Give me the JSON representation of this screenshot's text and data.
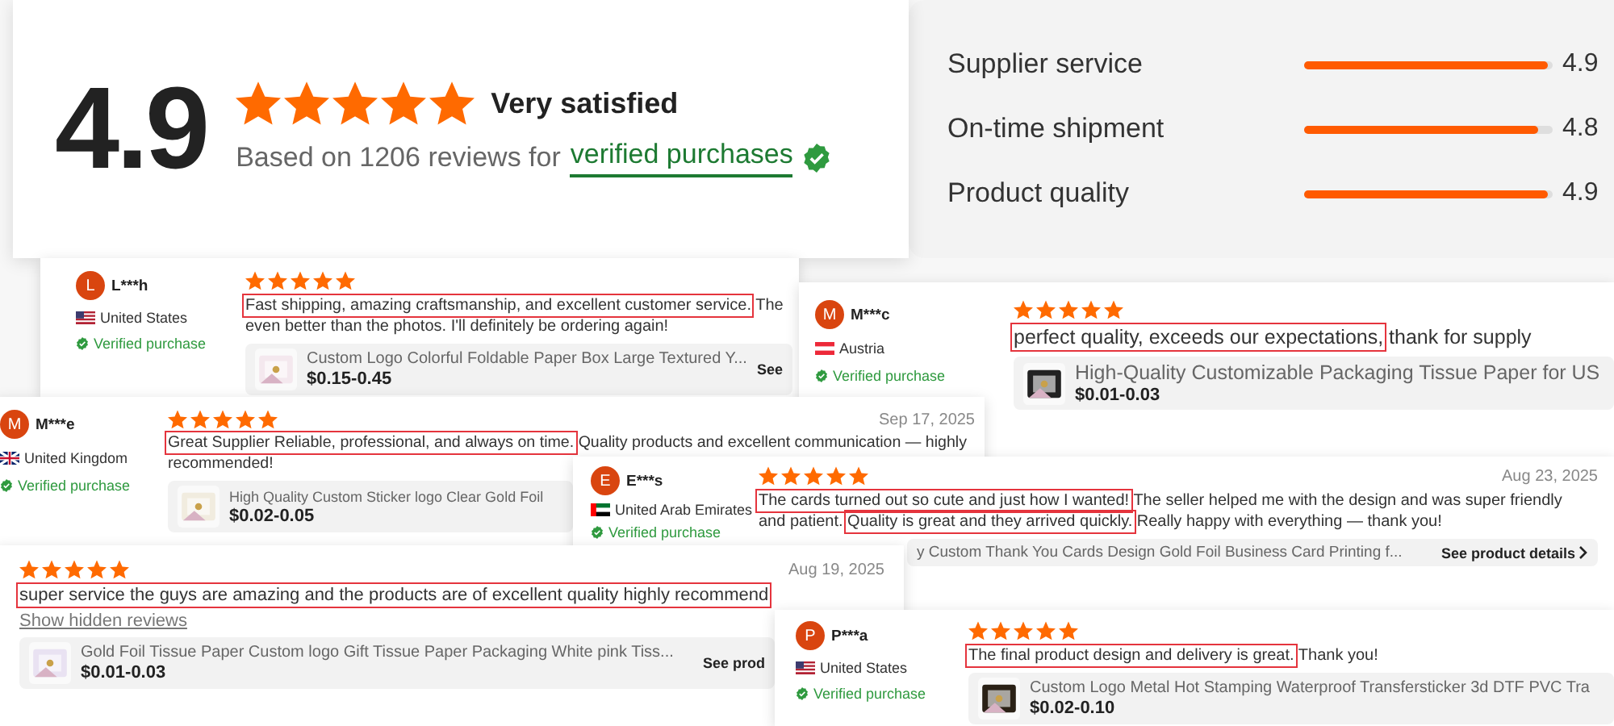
{
  "summary": {
    "score": "4.9",
    "stars": 5,
    "verdict": "Very satisfied",
    "based_on": "Based on 1206 reviews for",
    "link": "verified purchases"
  },
  "ratings": [
    {
      "label": "Supplier service",
      "level": 0.98,
      "value": "4.9"
    },
    {
      "label": "On-time shipment",
      "level": 0.94,
      "value": "4.8"
    },
    {
      "label": "Product quality",
      "level": 0.98,
      "value": "4.9"
    }
  ],
  "reviews": [
    {
      "author": {
        "initial": "L",
        "name": "L***h",
        "flag": {
          "kind": "us"
        },
        "country": "United States",
        "verified": "Verified purchase"
      },
      "stars": 5,
      "lines": [
        [
          {
            "text": "Fast shipping, amazing craftsmanship, and excellent customer service.",
            "boxed": true
          },
          {
            "text": " The",
            "boxed": false
          }
        ],
        [
          {
            "text": "even better than the photos. I'll definitely be ordering again!",
            "boxed": false
          }
        ]
      ],
      "product": {
        "has_image": true,
        "title": "Custom Logo Colorful Foldable Paper Box Large Textured Y...",
        "price": "$0.15-0.45",
        "link": "See"
      }
    },
    {
      "author": {
        "initial": "M",
        "name": "M***c",
        "flag": {
          "kind": "at"
        },
        "country": "Austria",
        "verified": "Verified purchase"
      },
      "stars": 5,
      "lines": [
        [
          {
            "text": "perfect quality, exceeds our expectations,",
            "boxed": true
          },
          {
            "text": " thank for supply",
            "boxed": false
          }
        ]
      ],
      "product": {
        "has_image": true,
        "title": "High-Quality Customizable Packaging Tissue Paper for US",
        "price": "$0.01-0.03"
      }
    },
    {
      "author": {
        "initial": "M",
        "name": "M***e",
        "flag": {
          "kind": "uk"
        },
        "country": "United Kingdom",
        "verified": "Verified purchase"
      },
      "stars": 5,
      "date": "Sep 17, 2025",
      "lines": [
        [
          {
            "text": "Great Supplier Reliable, professional, and always on time.",
            "boxed": true
          },
          {
            "text": " Quality products and excellent communication — highly",
            "boxed": false
          }
        ],
        [
          {
            "text": "recommended!",
            "boxed": false
          }
        ]
      ],
      "product": {
        "has_image": true,
        "title": "High Quality Custom Sticker logo Clear Gold Foil",
        "price": "$0.02-0.05"
      }
    },
    {
      "author": {
        "initial": "E",
        "name": "E***s",
        "flag": {
          "kind": "ae"
        },
        "country": "United Arab Emirates",
        "verified": "Verified purchase"
      },
      "stars": 5,
      "date": "Aug 23, 2025",
      "lines": [
        [
          {
            "text": "The cards turned out so cute and just how I wanted!",
            "boxed": true
          },
          {
            "text": " The seller helped me with the design and was super friendly",
            "boxed": false
          }
        ],
        [
          {
            "text": "and patient. ",
            "boxed": false
          },
          {
            "text": "Quality is great and they arrived quickly.",
            "boxed": true
          },
          {
            "text": " Really happy with everything — thank you!",
            "boxed": false
          }
        ]
      ],
      "product": {
        "has_image": false,
        "title": "y Custom Thank You Cards Design Gold Foil Business Card Printing f...",
        "link": "See product details"
      }
    },
    {
      "stars": 5,
      "date": "Aug 19, 2025",
      "lines": [
        [
          {
            "text": "super service the guys are amazing and the products are of excellent quality highly recommend",
            "boxed": true
          }
        ]
      ],
      "more": "Show hidden reviews",
      "product": {
        "has_image": true,
        "title": "Gold Foil Tissue Paper Custom logo Gift Tissue Paper Packaging White pink Tiss...",
        "price": "$0.01-0.03",
        "link": "See prod"
      }
    },
    {
      "author": {
        "initial": "P",
        "name": "P***a",
        "flag": {
          "kind": "us"
        },
        "country": "United States",
        "verified": "Verified purchase"
      },
      "stars": 5,
      "lines": [
        [
          {
            "text": "The final product design and delivery is great.",
            "boxed": true
          },
          {
            "text": " Thank you!",
            "boxed": false
          }
        ]
      ],
      "product": {
        "has_image": true,
        "title": "Custom Logo Metal Hot Stamping Waterproof Transfersticker 3d DTF PVC Tra",
        "price": "$0.02-0.10"
      }
    }
  ]
}
